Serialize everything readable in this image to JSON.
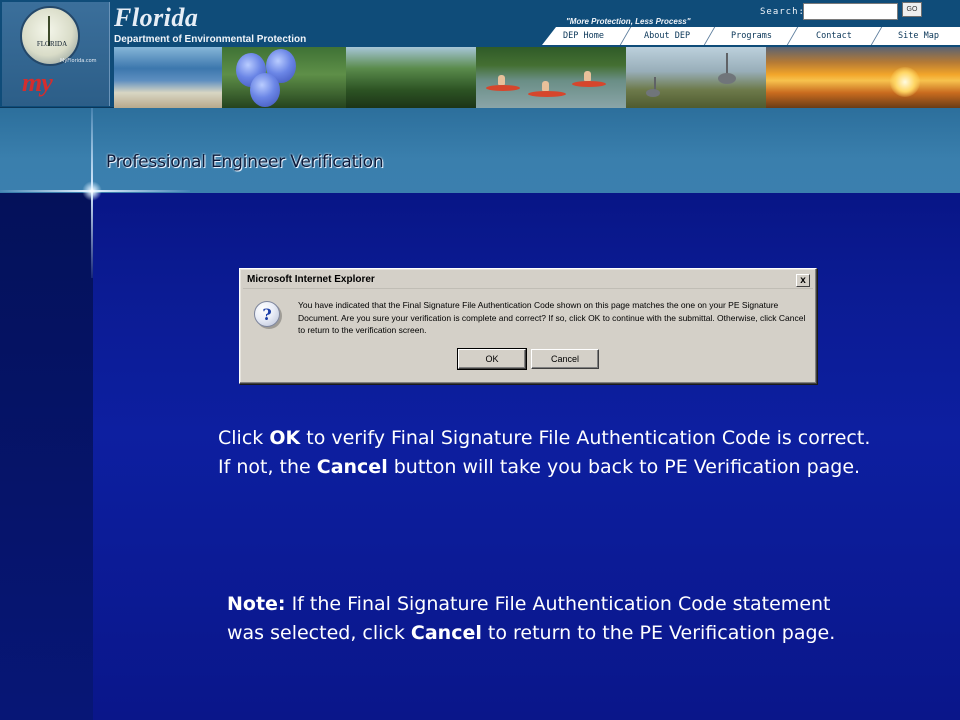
{
  "header": {
    "seal_text": "FLORIDA",
    "my_logo": "my",
    "myflorida_text": "MyFlorida.com",
    "state_name": "Florida",
    "department": "Department of Environmental Protection",
    "tagline": "\"More Protection, Less Process\"",
    "search_label": "Search:",
    "search_value": "",
    "go_label": "GO",
    "nav": [
      {
        "label": "DEP Home"
      },
      {
        "label": "About DEP"
      },
      {
        "label": "Programs"
      },
      {
        "label": "Contact"
      },
      {
        "label": "Site Map"
      }
    ]
  },
  "slide": {
    "title": "Professional Engineer Verification"
  },
  "dialog": {
    "title": "Microsoft Internet Explorer",
    "close_glyph": "x",
    "icon_glyph": "?",
    "message": "You have indicated that the Final Signature File Authentication Code shown on this page matches the one on your PE Signature Document.  Are you sure your verification is complete and correct? If so, click OK to continue with the submittal. Otherwise, click Cancel to return to the verification screen.",
    "ok_label": "OK",
    "cancel_label": "Cancel"
  },
  "instruction": {
    "t1": "Click ",
    "b1": "OK",
    "t2": " to verify Final Signature File Authentication Code is correct. If not, the ",
    "b2": "Cancel",
    "t3": " button will take you back to PE Verification page."
  },
  "note": {
    "b1": "Note:",
    "t1": " If the Final Signature File Authentication Code statement was selected, click ",
    "b2": "Cancel",
    "t2": " to return to the PE Verification page."
  }
}
